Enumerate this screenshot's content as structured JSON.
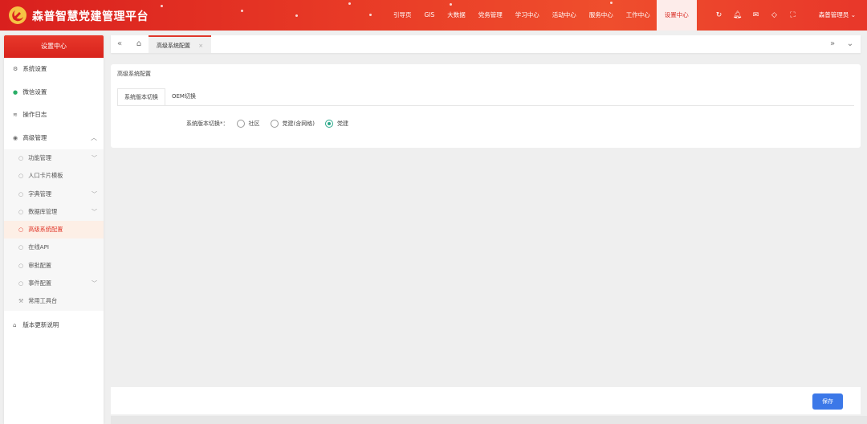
{
  "app": {
    "title": "森普智慧党建管理平台",
    "brand_color": "#e0382b"
  },
  "nav": {
    "items": [
      {
        "label": "引导页"
      },
      {
        "label": "GIS"
      },
      {
        "label": "大数据"
      },
      {
        "label": "党务管理"
      },
      {
        "label": "学习中心"
      },
      {
        "label": "活动中心"
      },
      {
        "label": "服务中心"
      },
      {
        "label": "工作中心"
      },
      {
        "label": "设置中心"
      }
    ],
    "active": "设置中心",
    "user_label": "森普管理员"
  },
  "toolbar_icons": [
    "refresh-icon",
    "bell-icon",
    "chat-icon",
    "tag-icon",
    "fullscreen-icon"
  ],
  "sidebar": {
    "header": "设置中心",
    "items": [
      {
        "label": "系统设置",
        "icon": "gear-icon"
      },
      {
        "label": "微信设置",
        "icon": "wechat-icon"
      },
      {
        "label": "操作日志",
        "icon": "layers-icon"
      },
      {
        "label": "高级管理",
        "icon": "eye-icon",
        "expanded": true
      }
    ],
    "sub_items": [
      {
        "label": "功能管理",
        "has_children": true
      },
      {
        "label": "人口卡片模板",
        "has_children": false
      },
      {
        "label": "字典管理",
        "has_children": true
      },
      {
        "label": "数据库管理",
        "has_children": true
      },
      {
        "label": "高级系统配置",
        "has_children": false,
        "active": true
      },
      {
        "label": "在线API",
        "has_children": false
      },
      {
        "label": "审批配置",
        "has_children": false
      },
      {
        "label": "事件配置",
        "has_children": true
      },
      {
        "label": "常用工具台",
        "has_children": false
      }
    ],
    "footer_item": {
      "label": "版本更新说明",
      "icon": "house-icon"
    }
  },
  "tabbar": {
    "open_tab": "高级系统配置"
  },
  "page": {
    "title": "高级系统配置",
    "tabs": [
      "系统版本切换",
      "OEM切换"
    ],
    "active_tab": "系统版本切换",
    "form": {
      "label": "系统版本切换*：",
      "options": [
        "社区",
        "党建(含网格)",
        "党建"
      ],
      "selected": "党建",
      "accent": "#2aa88a"
    },
    "save_label": "保存",
    "save_color": "#3c78e8"
  }
}
